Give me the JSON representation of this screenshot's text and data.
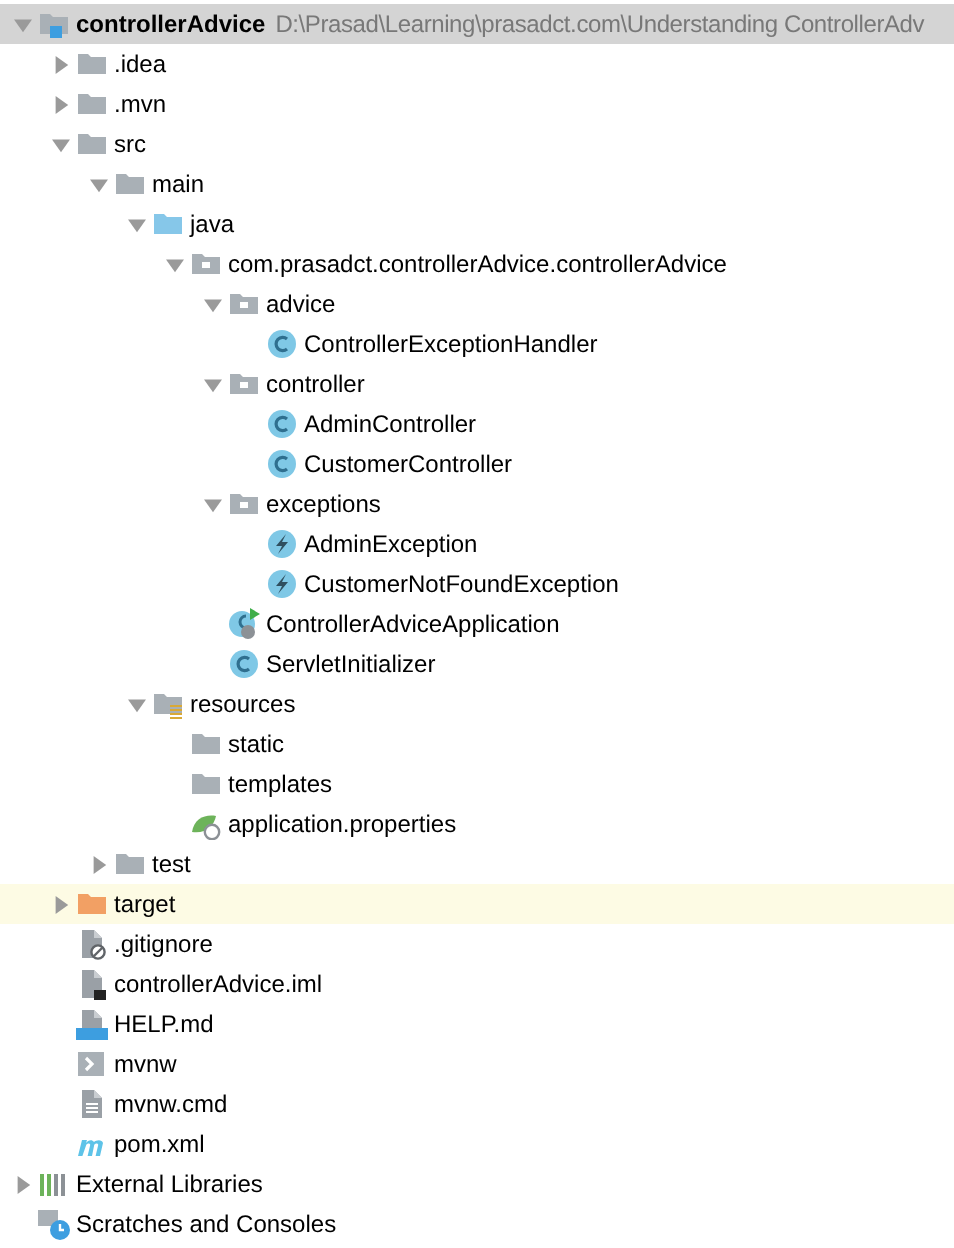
{
  "project_tree": [
    {
      "label": "controllerAdvice",
      "path": "D:\\Prasad\\Learning\\prasadct.com\\Understanding ControllerAdv",
      "kind": "module",
      "expanded": true,
      "selected": true,
      "children": [
        {
          "label": ".idea",
          "kind": "folder",
          "expanded": false,
          "selected": false
        },
        {
          "label": ".mvn",
          "kind": "folder",
          "expanded": false,
          "selected": false
        },
        {
          "label": "src",
          "kind": "folder",
          "expanded": true,
          "selected": false,
          "children": [
            {
              "label": "main",
              "kind": "folder",
              "expanded": true,
              "selected": false,
              "children": [
                {
                  "label": "java",
                  "kind": "source-folder",
                  "expanded": true,
                  "selected": false,
                  "children": [
                    {
                      "label": "com.prasadct.controllerAdvice.controllerAdvice",
                      "kind": "package",
                      "expanded": true,
                      "selected": false,
                      "children": [
                        {
                          "label": "advice",
                          "kind": "package",
                          "expanded": true,
                          "selected": false,
                          "children": [
                            {
                              "label": "ControllerExceptionHandler",
                              "kind": "class",
                              "selected": false
                            }
                          ]
                        },
                        {
                          "label": "controller",
                          "kind": "package",
                          "expanded": true,
                          "selected": false,
                          "children": [
                            {
                              "label": "AdminController",
                              "kind": "class",
                              "selected": false
                            },
                            {
                              "label": "CustomerController",
                              "kind": "class",
                              "selected": false
                            }
                          ]
                        },
                        {
                          "label": "exceptions",
                          "kind": "package",
                          "expanded": true,
                          "selected": false,
                          "children": [
                            {
                              "label": "AdminException",
                              "kind": "exception",
                              "selected": false
                            },
                            {
                              "label": "CustomerNotFoundException",
                              "kind": "exception",
                              "selected": false
                            }
                          ]
                        },
                        {
                          "label": "ControllerAdviceApplication",
                          "kind": "app-class",
                          "selected": false
                        },
                        {
                          "label": "ServletInitializer",
                          "kind": "class",
                          "selected": false
                        }
                      ]
                    }
                  ]
                },
                {
                  "label": "resources",
                  "kind": "resources-folder",
                  "expanded": true,
                  "selected": false,
                  "children": [
                    {
                      "label": "static",
                      "kind": "folder",
                      "selected": false
                    },
                    {
                      "label": "templates",
                      "kind": "folder",
                      "selected": false
                    },
                    {
                      "label": "application.properties",
                      "kind": "properties",
                      "selected": false
                    }
                  ]
                }
              ]
            },
            {
              "label": "test",
              "kind": "folder",
              "expanded": false,
              "selected": false
            }
          ]
        },
        {
          "label": "target",
          "kind": "excluded-folder",
          "expanded": false,
          "selected": false
        },
        {
          "label": ".gitignore",
          "kind": "ignore-file",
          "selected": false
        },
        {
          "label": "controllerAdvice.iml",
          "kind": "iml-file",
          "selected": false
        },
        {
          "label": "HELP.md",
          "kind": "md-file",
          "selected": false
        },
        {
          "label": "mvnw",
          "kind": "script-file",
          "selected": false
        },
        {
          "label": "mvnw.cmd",
          "kind": "text-file",
          "selected": false
        },
        {
          "label": "pom.xml",
          "kind": "maven-file",
          "selected": false
        }
      ]
    },
    {
      "label": "External Libraries",
      "kind": "libraries",
      "expanded": false,
      "selected": false
    },
    {
      "label": "Scratches and Consoles",
      "kind": "scratches",
      "selected": false
    }
  ]
}
